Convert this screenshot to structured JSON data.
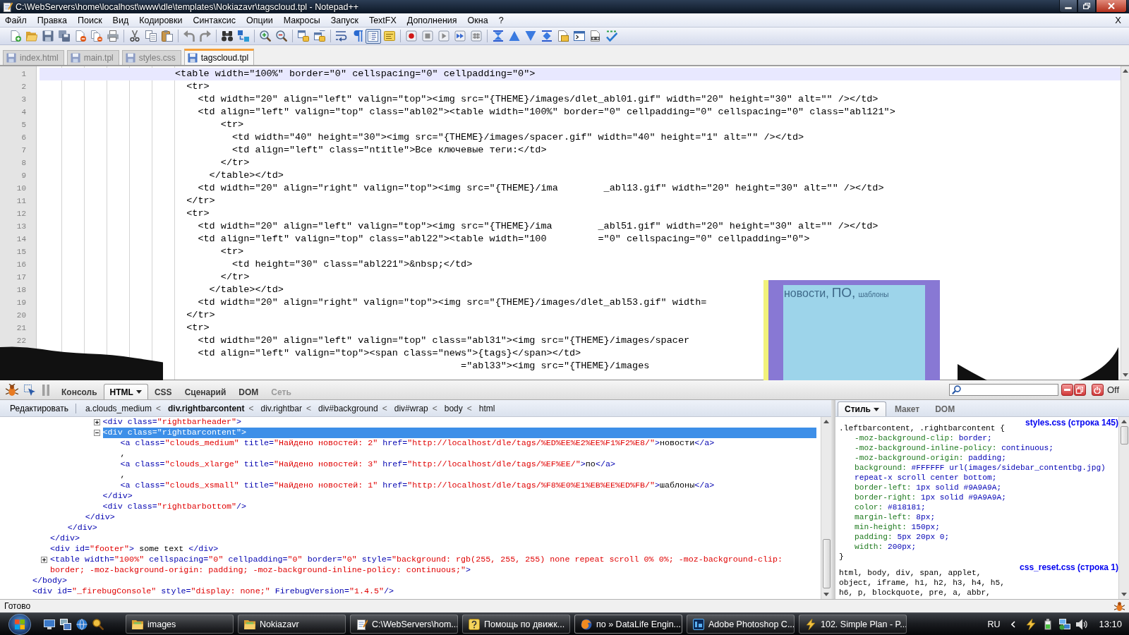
{
  "window": {
    "title": "C:\\WebServers\\home\\localhost\\www\\dle\\templates\\Nokiazavr\\tagscloud.tpl - Notepad++"
  },
  "menu": {
    "items": [
      "Файл",
      "Правка",
      "Поиск",
      "Вид",
      "Кодировки",
      "Синтаксис",
      "Опции",
      "Макросы",
      "Запуск",
      "TextFX",
      "Дополнения",
      "Окна",
      "?"
    ],
    "close": "X"
  },
  "toolbar": [
    [
      {
        "kind": "new",
        "on": false
      },
      {
        "kind": "open",
        "on": false
      },
      {
        "kind": "save",
        "on": false
      },
      {
        "kind": "saveall",
        "on": false
      },
      {
        "kind": "close",
        "on": false
      },
      {
        "kind": "closeall",
        "on": false
      },
      {
        "kind": "print",
        "on": false
      }
    ],
    [
      {
        "kind": "cut",
        "on": false
      },
      {
        "kind": "copy",
        "on": false
      },
      {
        "kind": "paste",
        "on": false
      }
    ],
    [
      {
        "kind": "undo",
        "on": false
      },
      {
        "kind": "redo",
        "on": false
      }
    ],
    [
      {
        "kind": "find",
        "on": false
      },
      {
        "kind": "replace",
        "on": false
      }
    ],
    [
      {
        "kind": "zoomin",
        "on": false
      },
      {
        "kind": "zoomout",
        "on": false
      }
    ],
    [
      {
        "kind": "syncv",
        "on": false
      },
      {
        "kind": "synch",
        "on": false
      }
    ],
    [
      {
        "kind": "wrap",
        "on": false
      },
      {
        "kind": "allchars",
        "on": false
      },
      {
        "kind": "indent",
        "on": true
      },
      {
        "kind": "userlang",
        "on": false
      }
    ],
    [
      {
        "kind": "record",
        "on": false
      },
      {
        "kind": "stop",
        "on": false
      },
      {
        "kind": "play",
        "on": false
      },
      {
        "kind": "playmulti",
        "on": false
      },
      {
        "kind": "savemacro",
        "on": false
      }
    ],
    [
      {
        "kind": "foldall",
        "on": false
      },
      {
        "kind": "up",
        "on": false
      },
      {
        "kind": "down",
        "on": false
      },
      {
        "kind": "unfoldall",
        "on": false
      },
      {
        "kind": "monitor",
        "on": false
      },
      {
        "kind": "console",
        "on": false
      },
      {
        "kind": "preview",
        "on": false
      },
      {
        "kind": "spell",
        "on": false
      }
    ]
  ],
  "tabs": [
    {
      "label": "index.html",
      "selected": false
    },
    {
      "label": "main.tpl",
      "selected": false
    },
    {
      "label": "styles.css",
      "selected": false
    },
    {
      "label": "tagscloud.tpl",
      "selected": true
    }
  ],
  "editor": {
    "lines": [
      {
        "number": "1",
        "current": true,
        "text": "<table width=\"100%\" border=\"0\" cellspacing=\"0\" cellpadding=\"0\">"
      },
      {
        "number": "2",
        "current": false,
        "text": "  <tr>"
      },
      {
        "number": "3",
        "current": false,
        "text": "    <td width=\"20\" align=\"left\" valign=\"top\"><img src=\"{THEME}/images/dlet_abl01.gif\" width=\"20\" height=\"30\" alt=\"\" /></td>"
      },
      {
        "number": "4",
        "current": false,
        "text": "    <td align=\"left\" valign=\"top\" class=\"abl02\"><table width=\"100%\" border=\"0\" cellpadding=\"0\" cellspacing=\"0\" class=\"abl121\">"
      },
      {
        "number": "5",
        "current": false,
        "text": "        <tr>"
      },
      {
        "number": "6",
        "current": false,
        "text": "          <td width=\"40\" height=\"30\"><img src=\"{THEME}/images/spacer.gif\" width=\"40\" height=\"1\" alt=\"\" /></td>"
      },
      {
        "number": "7",
        "current": false,
        "text": "          <td align=\"left\" class=\"ntitle\">Все ключевые теги:</td>"
      },
      {
        "number": "8",
        "current": false,
        "text": "        </tr>"
      },
      {
        "number": "9",
        "current": false,
        "text": "      </table></td>"
      },
      {
        "number": "10",
        "current": false,
        "text": "    <td width=\"20\" align=\"right\" valign=\"top\"><img src=\"{THEME}/ima        _abl13.gif\" width=\"20\" height=\"30\" alt=\"\" /></td>"
      },
      {
        "number": "11",
        "current": false,
        "text": "  </tr>"
      },
      {
        "number": "12",
        "current": false,
        "text": "  <tr>"
      },
      {
        "number": "13",
        "current": false,
        "text": "    <td width=\"20\" align=\"left\" valign=\"top\"><img src=\"{THEME}/ima        _abl51.gif\" width=\"20\" height=\"30\" alt=\"\" /></td>"
      },
      {
        "number": "14",
        "current": false,
        "text": "    <td align=\"left\" valign=\"top\" class=\"abl22\"><table width=\"100         =\"0\" cellspacing=\"0\" cellpadding=\"0\">"
      },
      {
        "number": "15",
        "current": false,
        "text": "        <tr>"
      },
      {
        "number": "16",
        "current": false,
        "text": "          <td height=\"30\" class=\"abl221\">&nbsp;</td>"
      },
      {
        "number": "17",
        "current": false,
        "text": "        </tr>"
      },
      {
        "number": "18",
        "current": false,
        "text": "      </table></td>"
      },
      {
        "number": "19",
        "current": false,
        "text": "    <td width=\"20\" align=\"right\" valign=\"top\"><img src=\"{THEME}/images/dlet_abl53.gif\" width="
      },
      {
        "number": "20",
        "current": false,
        "text": "  </tr>"
      },
      {
        "number": "21",
        "current": false,
        "text": "  <tr>"
      },
      {
        "number": "22",
        "current": false,
        "text": "    <td width=\"20\" align=\"left\" valign=\"top\" class=\"abl31\"><img src=\"{THEME}/images/spacer"
      },
      {
        "current": false,
        "text": "    <td align=\"left\" valign=\"top\"><span class=\"news\">{tags}</span></td>"
      },
      {
        "current": false,
        "text": "                                                  =\"abl33\"><img src=\"{THEME}/images"
      }
    ]
  },
  "preview": {
    "tags": [
      {
        "text": "новости,",
        "kind": "medium"
      },
      {
        "text": "ПО,",
        "kind": "xlarge"
      },
      {
        "text": "шаблоны",
        "kind": "xsmall"
      }
    ]
  },
  "firebug": {
    "tabs": [
      {
        "label": "Консоль",
        "selected": false,
        "disabled": false
      },
      {
        "label": "HTML",
        "selected": true,
        "disabled": false
      },
      {
        "label": "CSS",
        "selected": false,
        "disabled": false
      },
      {
        "label": "Сценарий",
        "selected": false,
        "disabled": false
      },
      {
        "label": "DOM",
        "selected": false,
        "disabled": false
      },
      {
        "label": "Сеть",
        "selected": false,
        "disabled": true
      }
    ],
    "off_label": "Off",
    "edit_button": "Редактировать",
    "breadcrumbs": [
      {
        "label": "a.clouds_medium",
        "sep": "<",
        "selected": false
      },
      {
        "label": "div.rightbarcontent",
        "sep": "<",
        "selected": true
      },
      {
        "label": "div.rightbar",
        "sep": "<",
        "selected": false
      },
      {
        "label": "div#background",
        "sep": "<",
        "selected": false
      },
      {
        "label": "div#wrap",
        "sep": "<",
        "selected": false
      },
      {
        "label": "body",
        "sep": "<",
        "selected": false
      },
      {
        "label": "html",
        "selected": false
      }
    ],
    "html_tree": [
      {
        "end": "</body>",
        "children": [
          {
            "end": "</div>",
            "children": [
              {
                "end": "</div>",
                "children": [
                  {
                    "end": "</div>",
                    "children": [
                      {
                        "line": "<div class=\"rightbarheader\">",
                        "expanded": false,
                        "selected": false
                      },
                      {
                        "line": "<div class=\"rightbarcontent\">",
                        "expanded": true,
                        "selected": true,
                        "children": [
                          {
                            "line": "<a class=\"clouds_medium\" title=\"Найдено новостей: 2\" href=\"http://localhost/dle/tags/%ED%EE%E2%EE%F1%F2%E8/\">новости</a>",
                            "selected": false
                          },
                          {
                            "line": ",",
                            "selected": false
                          },
                          {
                            "line": "<a class=\"clouds_xlarge\" title=\"Найдено новостей: 3\" href=\"http://localhost/dle/tags/%EF%EE/\">по</a>",
                            "selected": false
                          },
                          {
                            "line": ",",
                            "selected": false
                          },
                          {
                            "line": "<a class=\"clouds_xsmall\" title=\"Найдено новостей: 1\" href=\"http://localhost/dle/tags/%F8%E0%E1%EB%EE%ED%FB/\">шаблоны</a>",
                            "selected": false
                          }
                        ],
                        "end": "</div>"
                      },
                      {
                        "line": "<div class=\"rightbarbottom\"/>",
                        "selected": false
                      }
                    ]
                  }
                ]
              }
            ]
          },
          {
            "line": "<div id=\"footer\"> some text </div>",
            "selected": false
          },
          {
            "line": "<table width=\"100%\" cellspacing=\"0\" cellpadding=\"0\" border=\"0\" style=\"background: rgb(255, 255, 255) none repeat scroll 0% 0%; -moz-background-clip: border; -moz-background-origin: padding; -moz-background-inline-policy: continuous;\">",
            "expanded": false,
            "selected": false
          }
        ]
      },
      {
        "line": "<div id=\"_firebugConsole\" style=\"display: none;\" FirebugVersion=\"1.4.5\"/>",
        "selected": false
      }
    ],
    "side_tabs": [
      {
        "label": "Стиль",
        "selected": true
      },
      {
        "label": "Макет",
        "selected": false
      },
      {
        "label": "DOM",
        "selected": false
      }
    ],
    "style_rules": [
      {
        "source": "styles.css (строка 145)",
        "selector_lines": [
          ".leftbarcontent, .rightbarcontent {"
        ],
        "declarations": [
          {
            "name": "-moz-background-clip:",
            "value": "border;"
          },
          {
            "name": "-moz-background-inline-policy:",
            "value": "continuous;"
          },
          {
            "name": "-moz-background-origin:",
            "value": "padding;"
          },
          {
            "name": "background:",
            "value": "#FFFFFF url(images/sidebar_contentbg.jpg) repeat-x scroll center bottom;"
          },
          {
            "name": "border-left:",
            "value": "1px solid #9A9A9A;"
          },
          {
            "name": "border-right:",
            "value": "1px solid #9A9A9A;"
          },
          {
            "name": "color:",
            "value": "#818181;"
          },
          {
            "name": "margin-left:",
            "value": "8px;"
          },
          {
            "name": "min-height:",
            "value": "150px;"
          },
          {
            "name": "padding:",
            "value": "5px 20px 0;"
          },
          {
            "name": "width:",
            "value": "200px;"
          }
        ],
        "close": "}"
      },
      {
        "source": "css_reset.css (строка 1)",
        "selector_lines": [
          "html, body, div, span, applet,",
          "object, iframe, h1, h2, h3, h4, h5,",
          "h6, p, blockquote, pre, a, abbr,"
        ]
      }
    ]
  },
  "status_bar": {
    "text": "Готово"
  },
  "taskbar": {
    "tasks": [
      {
        "label": "images",
        "kind": "folder",
        "selected": false
      },
      {
        "label": "Nokiazavr",
        "kind": "folder",
        "selected": false
      },
      {
        "label": "C:\\WebServers\\hom...",
        "kind": "notepad",
        "selected": false
      },
      {
        "label": "Помощь по движк...",
        "kind": "help",
        "selected": false
      },
      {
        "label": "по » DataLife Engin...",
        "kind": "browser",
        "selected": true
      },
      {
        "label": "Adobe Photoshop C...",
        "kind": "tile",
        "selected": false
      },
      {
        "label": "102. Simple Plan - P...",
        "kind": "player",
        "selected": false
      }
    ],
    "language": "RU",
    "time": "13:10"
  }
}
